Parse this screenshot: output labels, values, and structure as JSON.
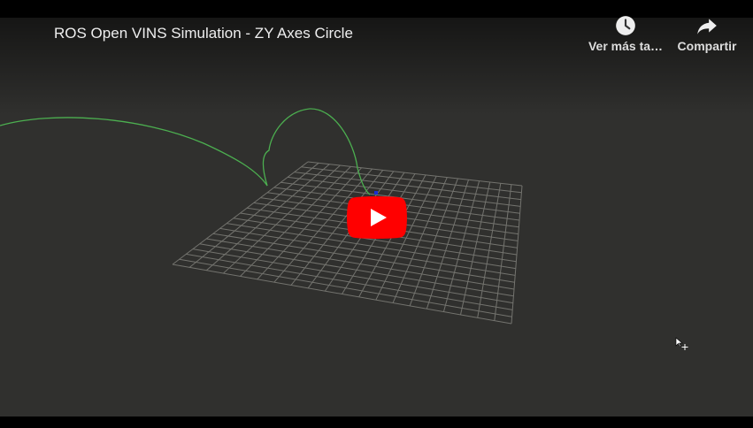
{
  "video": {
    "title": "ROS Open VINS Simulation - ZY Axes Circle"
  },
  "actions": {
    "watch_later_label": "Ver más ta…",
    "share_label": "Compartir"
  },
  "icons": {
    "watch_later": "clock-icon",
    "share": "share-arrow-icon",
    "play": "youtube-play-icon",
    "cursor": "move-cursor-icon"
  },
  "colors": {
    "background": "#30302e",
    "trajectory": "#4caf50",
    "grid": "#8a8a84",
    "play_button": "#ff0000"
  }
}
